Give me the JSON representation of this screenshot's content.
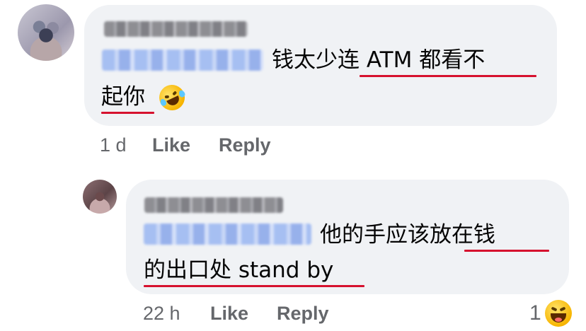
{
  "comment1": {
    "text": "钱太少连 ATM 都看不",
    "text_line2": "起你",
    "time": "1 d",
    "like": "Like",
    "reply": "Reply"
  },
  "comment2": {
    "text": "他的手应该放在钱",
    "text_line2": "的出口处 stand by",
    "time": "22 h",
    "like": "Like",
    "reply": "Reply",
    "reaction_count": "1"
  },
  "icons": {
    "emoji1": "rolling-on-floor-laughing-emoji-icon",
    "reaction": "laughing-reaction-icon"
  },
  "colors": {
    "bubble": "#f0f2f5",
    "text": "#050505",
    "meta": "#65676b",
    "underline": "#d6112e",
    "tag": "#9fbaf2"
  }
}
